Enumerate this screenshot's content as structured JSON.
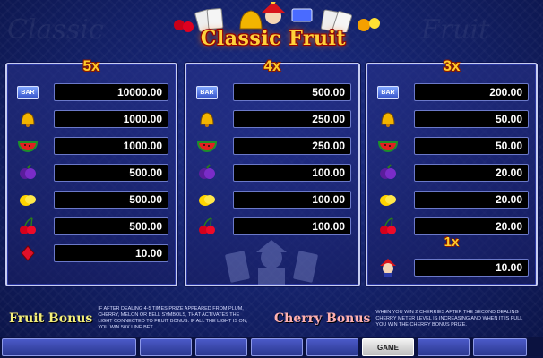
{
  "title": "Classic Fruit",
  "panels": [
    {
      "multiplier": "5x",
      "rows": [
        {
          "symbol": "bar-icon",
          "value": "10000.00"
        },
        {
          "symbol": "bell-icon",
          "value": "1000.00"
        },
        {
          "symbol": "watermelon-icon",
          "value": "1000.00"
        },
        {
          "symbol": "plum-icon",
          "value": "500.00"
        },
        {
          "symbol": "lemon-icon",
          "value": "500.00"
        },
        {
          "symbol": "cherry-icon",
          "value": "500.00"
        },
        {
          "symbol": "diamond-icon",
          "value": "10.00"
        }
      ]
    },
    {
      "multiplier": "4x",
      "rows": [
        {
          "symbol": "bar-icon",
          "value": "500.00"
        },
        {
          "symbol": "bell-icon",
          "value": "250.00"
        },
        {
          "symbol": "watermelon-icon",
          "value": "250.00"
        },
        {
          "symbol": "plum-icon",
          "value": "100.00"
        },
        {
          "symbol": "lemon-icon",
          "value": "100.00"
        },
        {
          "symbol": "cherry-icon",
          "value": "100.00"
        }
      ]
    },
    {
      "multiplier": "3x",
      "rows": [
        {
          "symbol": "bar-icon",
          "value": "200.00"
        },
        {
          "symbol": "bell-icon",
          "value": "50.00"
        },
        {
          "symbol": "watermelon-icon",
          "value": "50.00"
        },
        {
          "symbol": "plum-icon",
          "value": "20.00"
        },
        {
          "symbol": "lemon-icon",
          "value": "20.00"
        },
        {
          "symbol": "cherry-icon",
          "value": "20.00"
        }
      ],
      "extra": {
        "multiplier": "1x",
        "symbol": "jester-icon",
        "value": "10.00"
      }
    }
  ],
  "bar_label": "BAR",
  "fruit_bonus": {
    "title": "Fruit Bonus",
    "text": "If after dealing 4-5 times prize appeared from plum, cherry, melon or bell symbols, that activates the light connected to fruit bonus. If all the light is on, you win 50x line bet."
  },
  "cherry_bonus": {
    "title": "Cherry Bonus",
    "text": "When you win 2 cherries after the second dealing cherry meter level is increasing and when it is full you win the cherry bonus prize."
  },
  "buttons": [
    "",
    "",
    "",
    "",
    "",
    "GAME",
    "",
    ""
  ],
  "colors": {
    "accent": "#ffcc2a",
    "panel_border": "#c7cdf2",
    "background": "#132066"
  }
}
